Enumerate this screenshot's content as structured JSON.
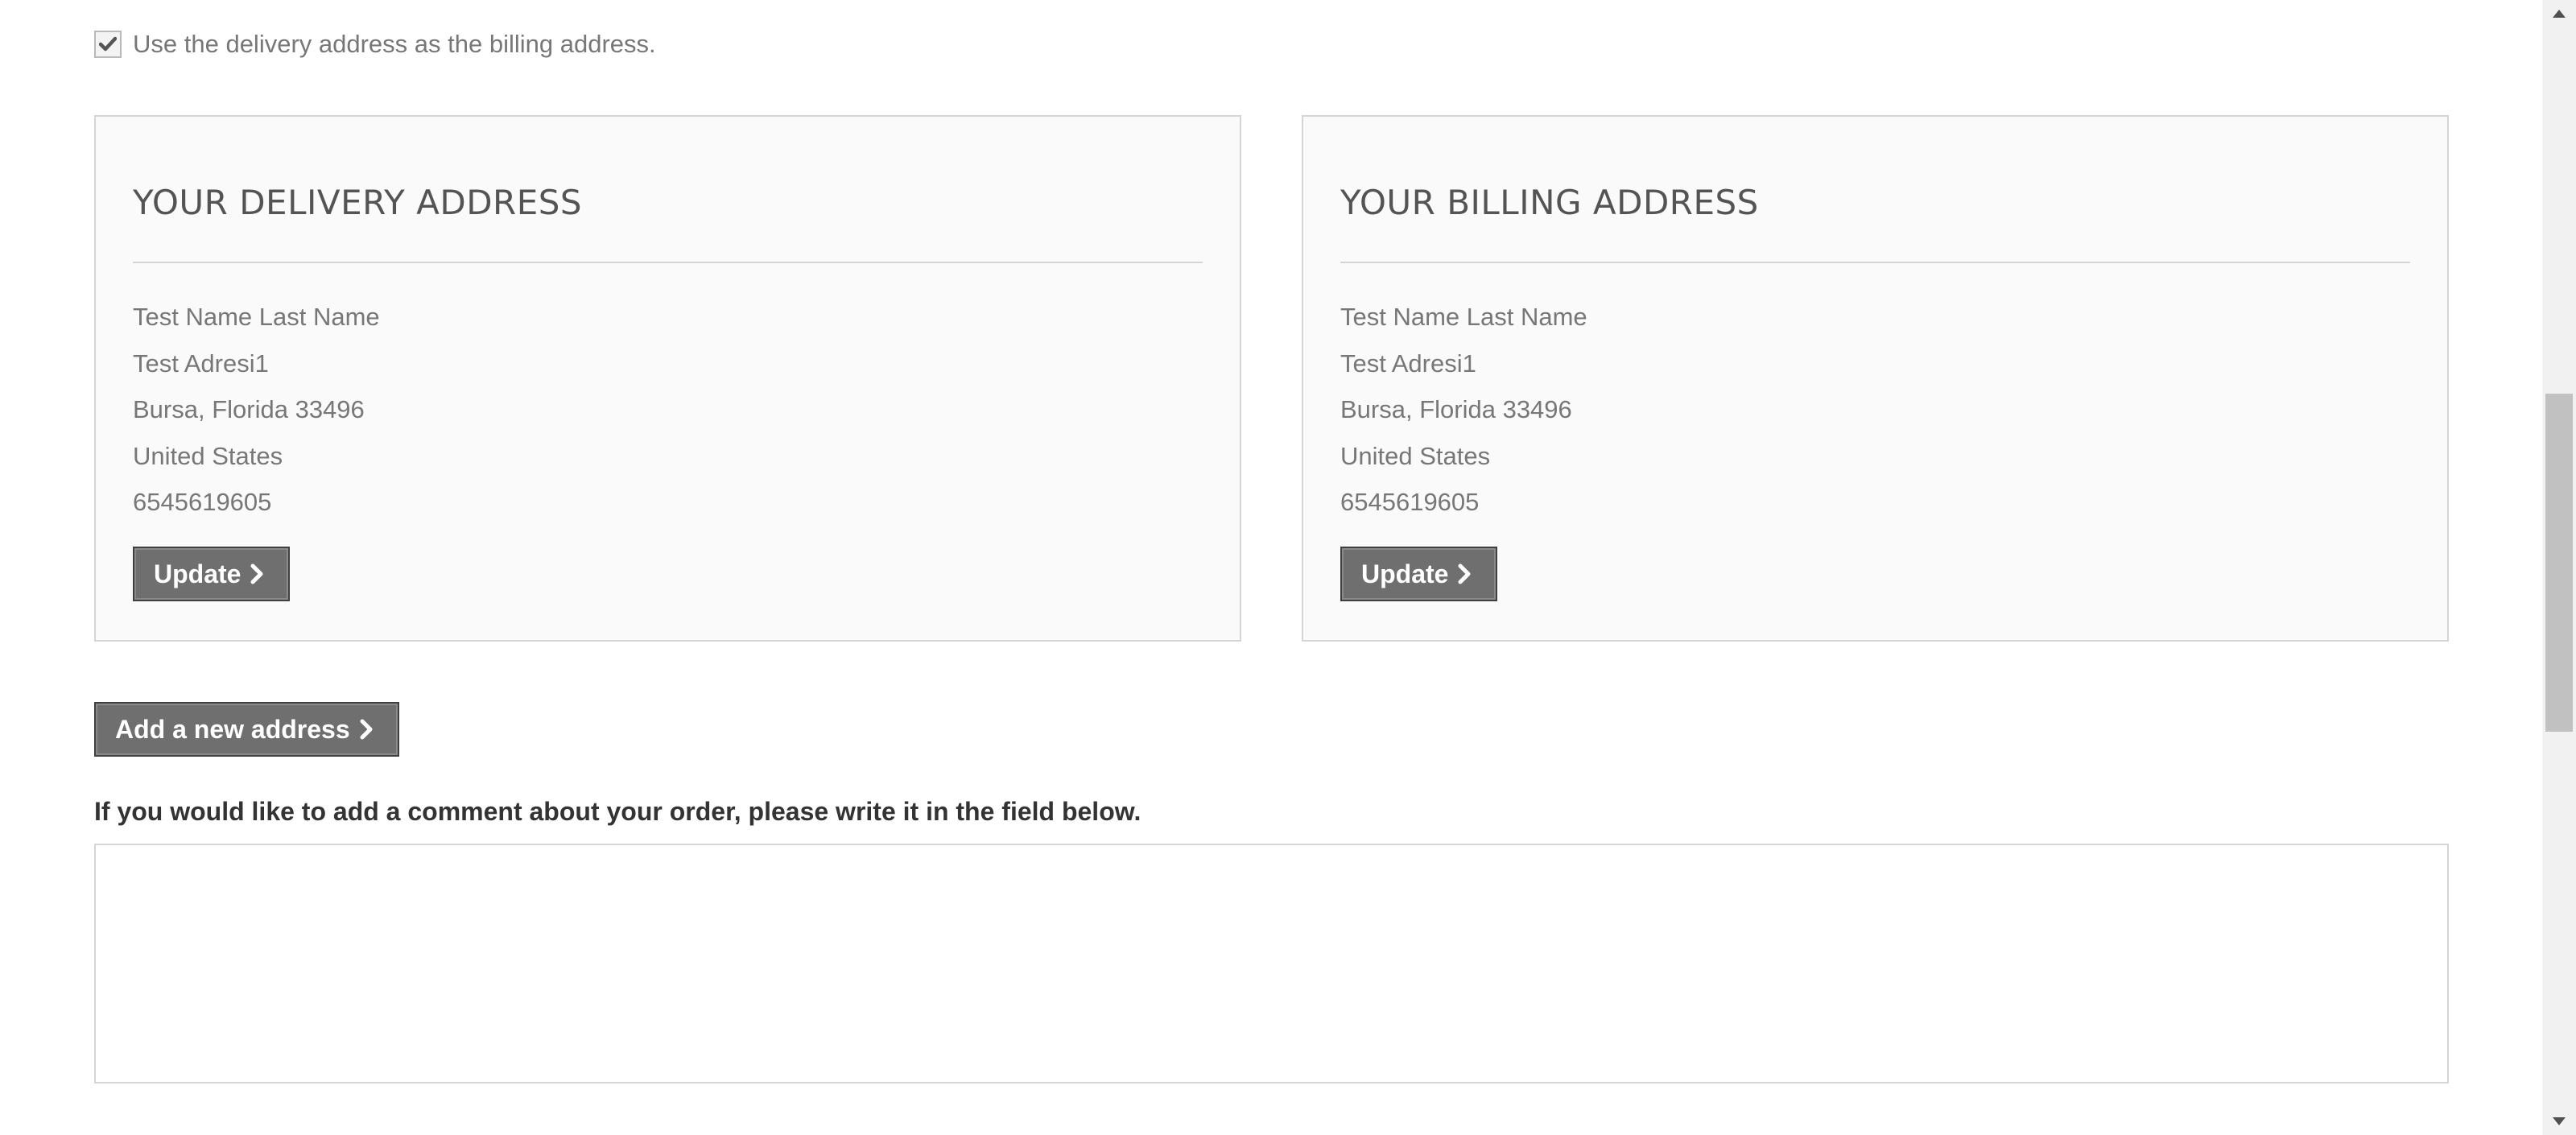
{
  "billing_same_as_delivery": {
    "checked": true,
    "label": "Use the delivery address as the billing address."
  },
  "delivery_address": {
    "title": "YOUR DELIVERY ADDRESS",
    "lines": [
      "Test Name Last Name",
      "Test Adresi1",
      "Bursa, Florida 33496",
      "United States",
      "6545619605"
    ],
    "update_label": "Update"
  },
  "billing_address": {
    "title": "YOUR BILLING ADDRESS",
    "lines": [
      "Test Name Last Name",
      "Test Adresi1",
      "Bursa, Florida 33496",
      "United States",
      "6545619605"
    ],
    "update_label": "Update"
  },
  "add_address": {
    "label": "Add a new address"
  },
  "comment": {
    "label": "If you would like to add a comment about your order, please write it in the field below.",
    "value": ""
  },
  "icons": {
    "checkbox_check": "check-icon",
    "button_arrow": "chevron-right-icon",
    "scroll_up": "triangle-up-icon",
    "scroll_down": "triangle-down-icon"
  },
  "colors": {
    "button_bg": "#6f6f6f",
    "box_bg": "#fafafa",
    "box_border": "#d6d4d4",
    "heading": "#555454",
    "text": "#777777"
  }
}
